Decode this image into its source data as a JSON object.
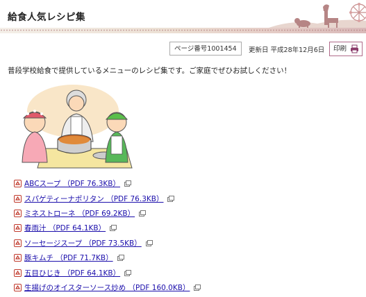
{
  "header": {
    "title": "給食人気レシピ集"
  },
  "meta": {
    "page_number": "ページ番号1001454",
    "updated": "更新日 平成28年12月6日",
    "print_label": "印刷"
  },
  "intro": "普段学校給食で提供しているメニューのレシピ集です。ご家庭でぜひお試しください！",
  "recipes": [
    {
      "label": "ABCスープ （PDF 76.3KB）"
    },
    {
      "label": "スパゲティーナポリタン （PDF 76.3KB）"
    },
    {
      "label": "ミネストローネ （PDF 69.2KB）"
    },
    {
      "label": "春雨汁 （PDF 64.1KB）"
    },
    {
      "label": "ソーセージスープ （PDF 73.5KB）"
    },
    {
      "label": "豚キムチ （PDF 71.7KB）"
    },
    {
      "label": "五目ひじき （PDF 64.1KB）"
    },
    {
      "label": "生揚げのオイスターソース炒め （PDF 160.0KB）"
    }
  ],
  "colors": {
    "link": "#1a0dab",
    "print_border": "#b06a8a",
    "pdf_icon": "#c0392b",
    "header_band": "#e6cfc8"
  },
  "icons": [
    "pdf-icon",
    "external-link-icon",
    "printer-icon"
  ]
}
